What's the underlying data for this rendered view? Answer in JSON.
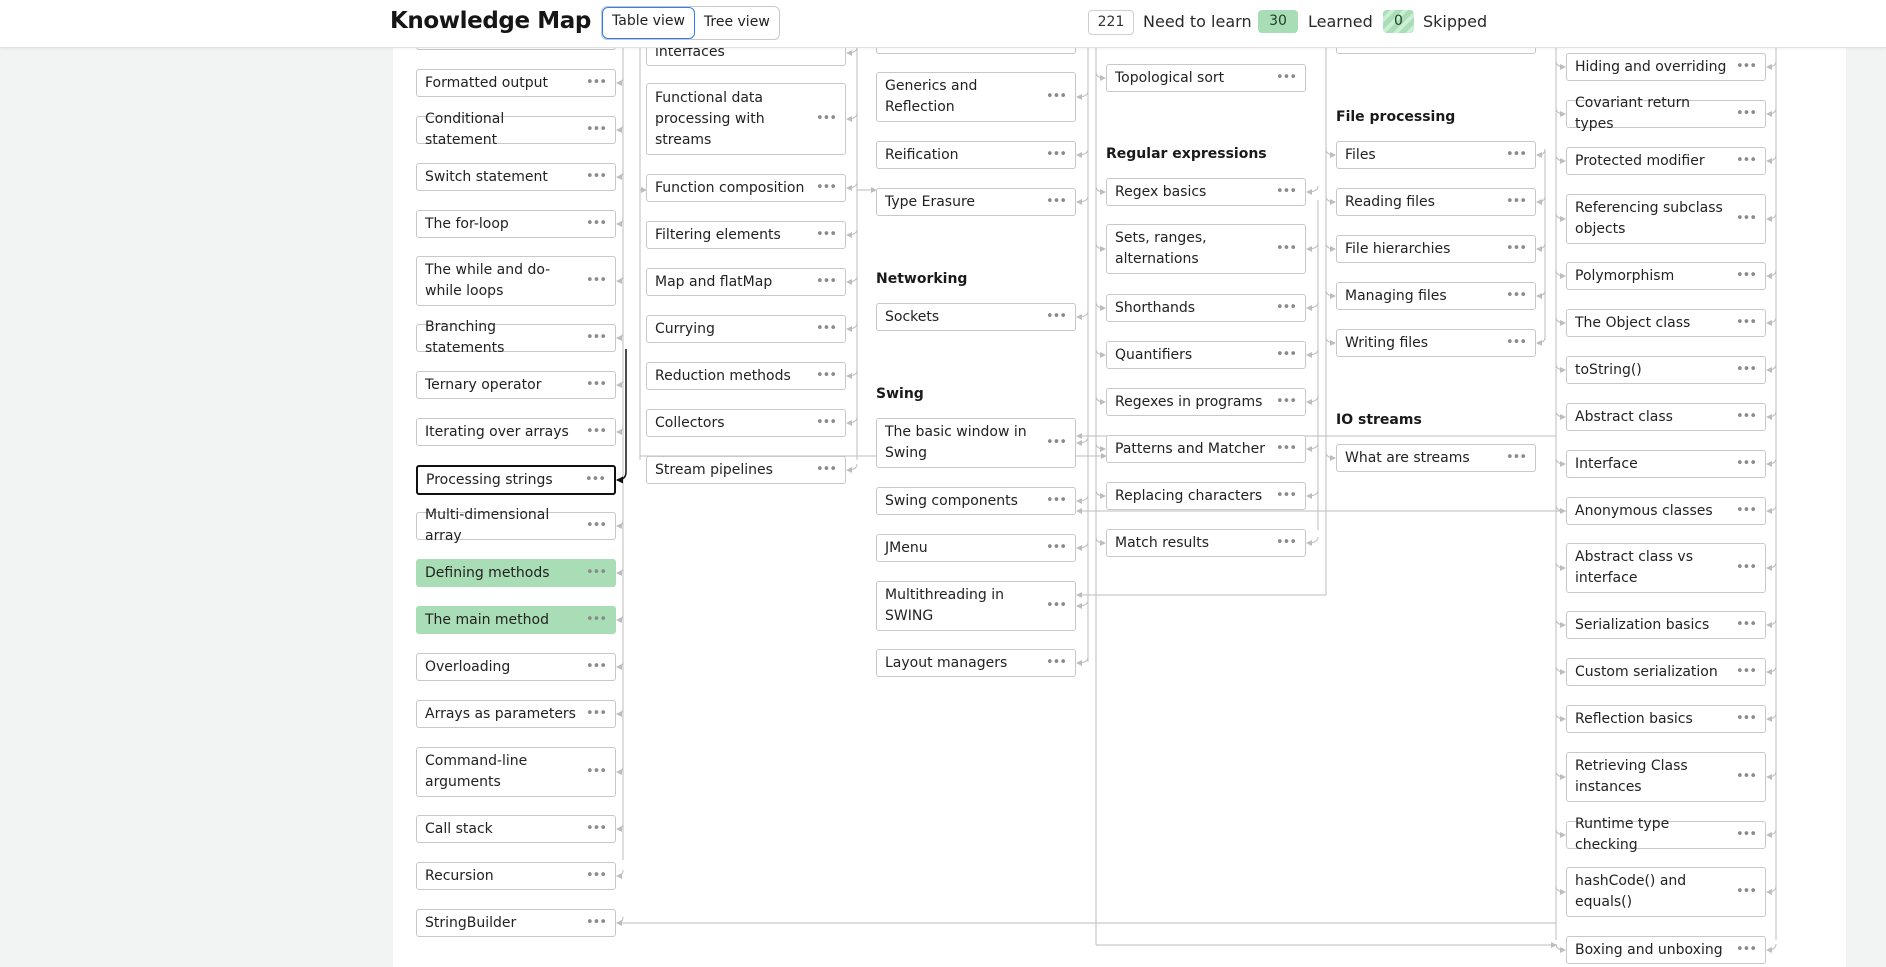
{
  "header": {
    "title": "Knowledge Map",
    "view_tabs": [
      {
        "label": "Table view",
        "active": true
      },
      {
        "label": "Tree view",
        "active": false
      }
    ],
    "stats": {
      "need_count": "221",
      "need_label": "Need to learn",
      "learned_count": "30",
      "learned_label": "Learned",
      "skipped_count": "0",
      "skipped_label": "Skipped"
    }
  },
  "colors": {
    "learned": "#a8ddb5",
    "accent_blue": "#2f7cf6",
    "connector": "#bdbdbd",
    "selected_border": "#111111"
  },
  "icons": {
    "node_menu": "ellipsis-icon"
  },
  "columns": {
    "col1": {
      "heading": "",
      "nodes": [
        {
          "label": "Formatted output",
          "status": ""
        },
        {
          "label": "Conditional statement",
          "status": ""
        },
        {
          "label": "Switch statement",
          "status": ""
        },
        {
          "label": "The for-loop",
          "status": ""
        },
        {
          "label": "The while and do-while loops",
          "status": ""
        },
        {
          "label": "Branching statements",
          "status": ""
        },
        {
          "label": "Ternary operator",
          "status": ""
        },
        {
          "label": "Iterating over arrays",
          "status": ""
        },
        {
          "label": "Processing strings",
          "status": "selected"
        },
        {
          "label": "Multi-dimensional array",
          "status": ""
        },
        {
          "label": "Defining methods",
          "status": "learned"
        },
        {
          "label": "The main method",
          "status": "learned"
        },
        {
          "label": "Overloading",
          "status": ""
        },
        {
          "label": "Arrays as parameters",
          "status": ""
        },
        {
          "label": "Command-line arguments",
          "status": ""
        },
        {
          "label": "Call stack",
          "status": ""
        },
        {
          "label": "Recursion",
          "status": ""
        },
        {
          "label": "StringBuilder",
          "status": ""
        }
      ]
    },
    "col2": {
      "heading": "",
      "nodes": [
        {
          "label": "interfaces",
          "status": ""
        },
        {
          "label": "Functional data processing with streams",
          "status": ""
        },
        {
          "label": "Function composition",
          "status": ""
        },
        {
          "label": "Filtering elements",
          "status": ""
        },
        {
          "label": "Map and flatMap",
          "status": ""
        },
        {
          "label": "Currying",
          "status": ""
        },
        {
          "label": "Reduction methods",
          "status": ""
        },
        {
          "label": "Collectors",
          "status": ""
        },
        {
          "label": "Stream pipelines",
          "status": ""
        }
      ]
    },
    "col3": {
      "groups": [
        {
          "heading": "",
          "nodes": [
            {
              "label": "Generics and Reflection",
              "status": ""
            },
            {
              "label": "Reification",
              "status": ""
            },
            {
              "label": "Type Erasure",
              "status": ""
            }
          ]
        },
        {
          "heading": "Networking",
          "nodes": [
            {
              "label": "Sockets",
              "status": ""
            }
          ]
        },
        {
          "heading": "Swing",
          "nodes": [
            {
              "label": "The basic window in Swing",
              "status": ""
            },
            {
              "label": "Swing components",
              "status": ""
            },
            {
              "label": "JMenu",
              "status": ""
            },
            {
              "label": "Multithreading in SWING",
              "status": ""
            },
            {
              "label": "Layout managers",
              "status": ""
            }
          ]
        }
      ]
    },
    "col4": {
      "groups": [
        {
          "heading": "",
          "nodes": [
            {
              "label": "Topological sort",
              "status": ""
            }
          ]
        },
        {
          "heading": "Regular expressions",
          "nodes": [
            {
              "label": "Regex basics",
              "status": ""
            },
            {
              "label": "Sets, ranges, alternations",
              "status": ""
            },
            {
              "label": "Shorthands",
              "status": ""
            },
            {
              "label": "Quantifiers",
              "status": ""
            },
            {
              "label": "Regexes in programs",
              "status": ""
            },
            {
              "label": "Patterns and Matcher",
              "status": ""
            },
            {
              "label": "Replacing characters",
              "status": ""
            },
            {
              "label": "Match results",
              "status": ""
            }
          ]
        }
      ]
    },
    "col5": {
      "groups": [
        {
          "heading": "File processing",
          "nodes": [
            {
              "label": "Files",
              "status": ""
            },
            {
              "label": "Reading files",
              "status": ""
            },
            {
              "label": "File hierarchies",
              "status": ""
            },
            {
              "label": "Managing files",
              "status": ""
            },
            {
              "label": "Writing files",
              "status": ""
            }
          ]
        },
        {
          "heading": "IO streams",
          "nodes": [
            {
              "label": "What are streams",
              "status": ""
            }
          ]
        }
      ]
    },
    "col6": {
      "heading": "",
      "nodes": [
        {
          "label": "Hiding and overriding",
          "status": ""
        },
        {
          "label": "Covariant return types",
          "status": ""
        },
        {
          "label": "Protected modifier",
          "status": ""
        },
        {
          "label": "Referencing subclass objects",
          "status": ""
        },
        {
          "label": "Polymorphism",
          "status": ""
        },
        {
          "label": "The Object class",
          "status": ""
        },
        {
          "label": "toString()",
          "status": ""
        },
        {
          "label": "Abstract class",
          "status": ""
        },
        {
          "label": "Interface",
          "status": ""
        },
        {
          "label": "Anonymous classes",
          "status": ""
        },
        {
          "label": "Abstract class vs interface",
          "status": ""
        },
        {
          "label": "Serialization basics",
          "status": ""
        },
        {
          "label": "Custom serialization",
          "status": ""
        },
        {
          "label": "Reflection basics",
          "status": ""
        },
        {
          "label": "Retrieving Class instances",
          "status": ""
        },
        {
          "label": "Runtime type checking",
          "status": ""
        },
        {
          "label": "hashCode() and equals()",
          "status": ""
        },
        {
          "label": "Boxing and unboxing",
          "status": ""
        }
      ]
    }
  }
}
